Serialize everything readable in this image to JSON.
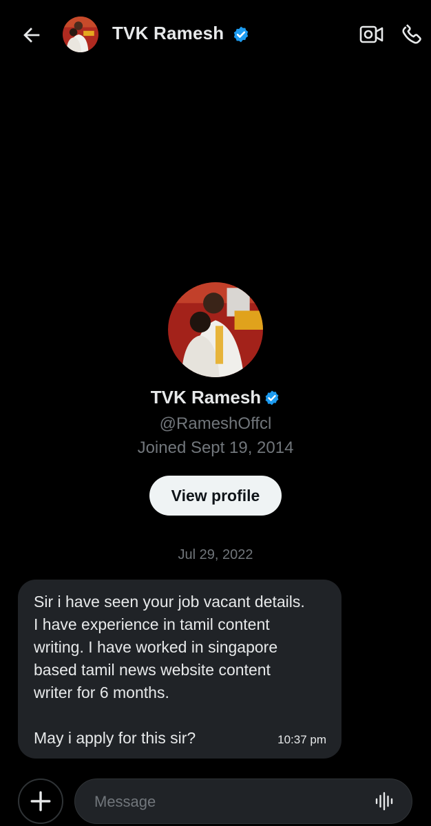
{
  "header": {
    "name": "TVK Ramesh",
    "icons": {
      "back": "back-arrow-icon",
      "verified": "verified-badge-icon",
      "video": "video-call-icon",
      "call": "phone-icon"
    }
  },
  "profile": {
    "name": "TVK Ramesh",
    "handle": "@RameshOffcl",
    "joined": "Joined Sept 19, 2014",
    "view_profile_label": "View profile"
  },
  "conversation": {
    "date": "Jul 29, 2022",
    "messages": [
      {
        "text": "Sir i have seen your job vacant details.\nI have experience in tamil content\nwriting. I have worked in singapore\nbased tamil news website content\nwriter for 6 months.\n\nMay i apply for this sir?",
        "time": "10:37 pm"
      }
    ]
  },
  "composer": {
    "placeholder": "Message",
    "icons": {
      "add": "plus-icon",
      "voice": "voice-wave-icon"
    }
  },
  "colors": {
    "background": "#000000",
    "bubble": "#202327",
    "muted_text": "#71767b",
    "verified": "#1d9bf0",
    "button_bg": "#eff3f4"
  }
}
